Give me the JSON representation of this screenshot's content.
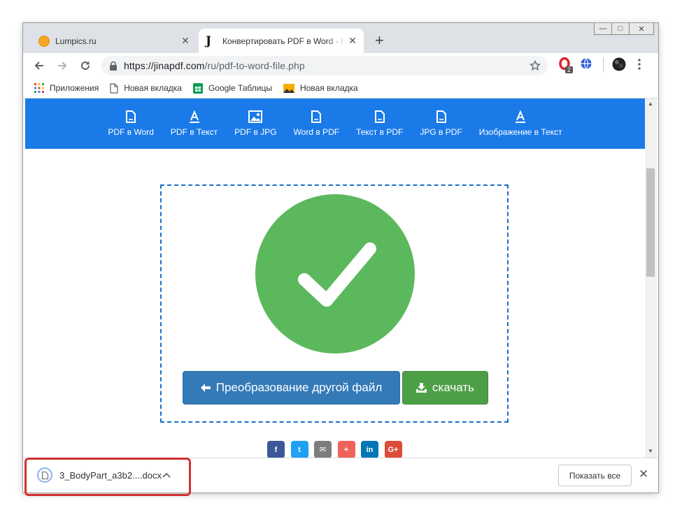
{
  "window": {
    "controls": {
      "minimize": "—",
      "maximize": "□",
      "close": "✕"
    }
  },
  "tabs": [
    {
      "title": "Lumpics.ru",
      "close": "✕"
    },
    {
      "title": "Конвертировать PDF в Word - PDF",
      "close": "✕"
    }
  ],
  "new_tab": "+",
  "toolbar": {
    "url_host": "https://jinapdf.com",
    "url_path": "/ru/pdf-to-word-file.php",
    "extension_badge": "2"
  },
  "bookmarks": [
    {
      "label": "Приложения",
      "icon": "apps-grid-icon"
    },
    {
      "label": "Новая вкладка",
      "icon": "page-icon"
    },
    {
      "label": "Google Таблицы",
      "icon": "sheets-icon"
    },
    {
      "label": "Новая вкладка",
      "icon": "image-icon"
    }
  ],
  "site_nav": [
    {
      "label": "PDF в Word",
      "icon": "doc-icon"
    },
    {
      "label": "PDF в Текст",
      "icon": "text-a-icon"
    },
    {
      "label": "PDF в JPG",
      "icon": "image-icon"
    },
    {
      "label": "Word в PDF",
      "icon": "doc-icon"
    },
    {
      "label": "Текст в PDF",
      "icon": "doc-icon"
    },
    {
      "label": "JPG в PDF",
      "icon": "doc-icon"
    },
    {
      "label": "Изображение в Текст",
      "icon": "text-a-icon"
    }
  ],
  "main": {
    "convert_button": "Преобразование другой файл",
    "download_button": "скачать"
  },
  "social": [
    {
      "label": "f",
      "color": "#3b5998"
    },
    {
      "label": "t",
      "color": "#1da1f2"
    },
    {
      "label": "✉",
      "color": "#7d7d7d"
    },
    {
      "label": "+",
      "color": "#f0625a"
    },
    {
      "label": "in",
      "color": "#0077b5"
    },
    {
      "label": "G+",
      "color": "#dd4b39"
    }
  ],
  "download_bar": {
    "file_name": "3_BodyPart_a3b2....docx",
    "show_all": "Показать все",
    "close": "✕"
  },
  "colors": {
    "site_nav_bg": "#1a7ae8",
    "success_green": "#5cb85c",
    "convert_btn": "#337ab7",
    "download_btn": "#4c9f46",
    "highlight": "#d32f2f"
  }
}
